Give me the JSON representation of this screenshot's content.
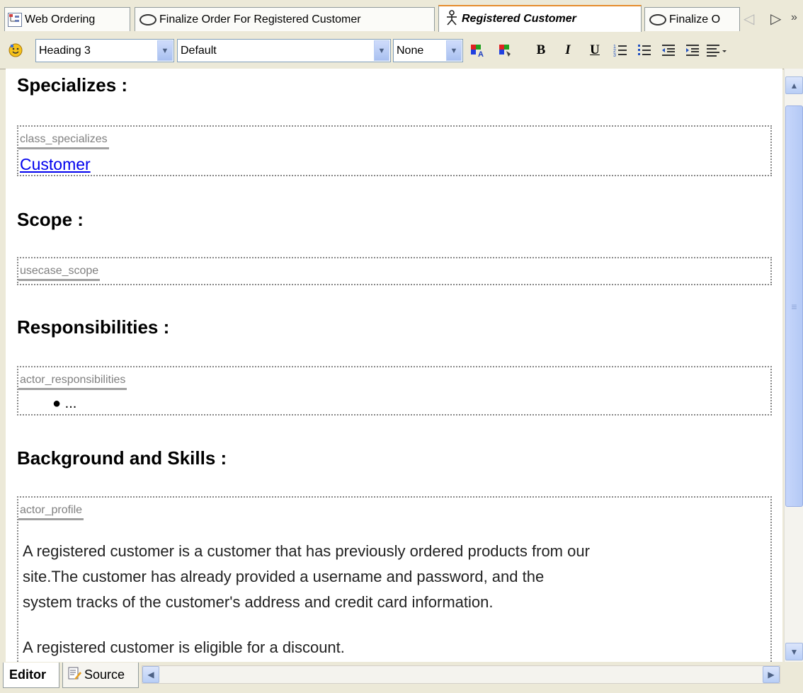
{
  "tabs": [
    {
      "label": "Web Ordering",
      "icon": "diagram-icon"
    },
    {
      "label": "Finalize Order For Registered Customer",
      "icon": "usecase-oval-icon"
    },
    {
      "label": "Registered Customer",
      "icon": "actor-icon",
      "active": true
    },
    {
      "label": "Finalize O",
      "icon": "usecase-oval-icon"
    }
  ],
  "toolbar": {
    "style_value": "Heading 3",
    "font_value": "Default",
    "size_value": "None",
    "bold": "B",
    "italic": "I",
    "underline": "U"
  },
  "document": {
    "sections": [
      {
        "heading": "Specializes :",
        "field_tag": "class_specializes",
        "link": "Customer"
      },
      {
        "heading": "Scope :",
        "field_tag": "usecase_scope"
      },
      {
        "heading": "Responsibilities :",
        "field_tag": "actor_responsibilities",
        "bullet": "..."
      },
      {
        "heading": "Background and Skills :",
        "field_tag": "actor_profile",
        "paragraph1_line1": "A registered customer is a customer that has previously ordered products from our",
        "paragraph1_line2": "site.The customer has already provided a username and password, and the",
        "paragraph1_line3": "system tracks of the customer's address and credit card information.",
        "paragraph2": "A registered customer is eligible for a discount."
      }
    ]
  },
  "bottom_tabs": {
    "editor": "Editor",
    "source": "Source"
  },
  "colors": {
    "active_tab_accent": "#e68b2c",
    "link": "#0000ee",
    "field_tag": "#808080",
    "chrome": "#ece9d8"
  }
}
